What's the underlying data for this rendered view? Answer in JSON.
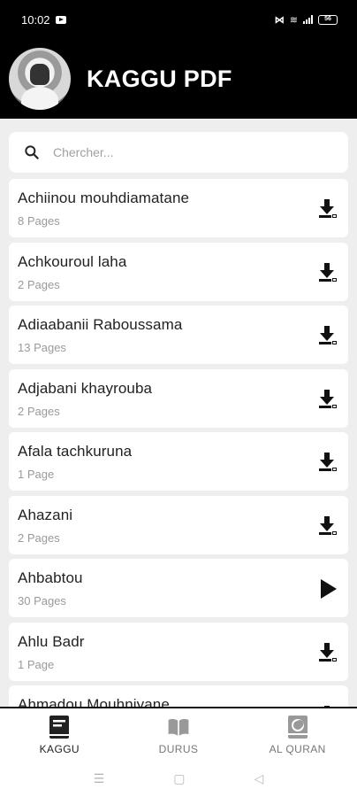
{
  "status": {
    "time": "10:02",
    "battery": "56"
  },
  "app": {
    "title": "KAGGU PDF"
  },
  "search": {
    "placeholder": "Chercher..."
  },
  "items": [
    {
      "title": "Achiinou mouhdiamatane",
      "pages": "8 Pages",
      "action": "download-icon"
    },
    {
      "title": "Achkouroul laha",
      "pages": "2 Pages",
      "action": "download-icon"
    },
    {
      "title": "Adiaabanii Raboussama",
      "pages": "13 Pages",
      "action": "download-icon"
    },
    {
      "title": "Adjabani khayrouba",
      "pages": "2 Pages",
      "action": "download-icon"
    },
    {
      "title": "Afala tachkuruna",
      "pages": "1 Page",
      "action": "download-icon"
    },
    {
      "title": "Ahazani",
      "pages": "2 Pages",
      "action": "download-icon"
    },
    {
      "title": "Ahbabtou",
      "pages": "30 Pages",
      "action": "play-icon"
    },
    {
      "title": "Ahlu Badr",
      "pages": "1 Page",
      "action": "download-icon"
    },
    {
      "title": "Ahmadou Mouhniyane",
      "pages": "",
      "action": "download-icon"
    }
  ],
  "nav": [
    {
      "label": "KAGGU",
      "icon": "book-icon",
      "active": true
    },
    {
      "label": "DURUS",
      "icon": "open-book-icon",
      "active": false
    },
    {
      "label": "AL QURAN",
      "icon": "quran-icon",
      "active": false
    }
  ],
  "colors": {
    "accent": "#000000",
    "background": "#eeeeee",
    "card": "#ffffff",
    "muted": "#9a9a9a"
  }
}
